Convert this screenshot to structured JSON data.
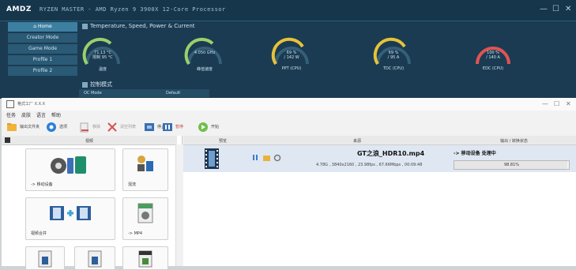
{
  "ryzen": {
    "logo": "AMDZ",
    "title": "RYZEN MASTER - AMD Ryzen 9 3900X 12-Core Processor",
    "nav": [
      "Home",
      "Creator Mode",
      "Game Mode",
      "Profile 1",
      "Profile 2"
    ],
    "section1": "Temperature, Speed, Power & Current",
    "gauges": [
      {
        "value": "71.13 °C\n限制 95 °C",
        "label": "温度",
        "color": "#9ad06a"
      },
      {
        "value": "4.050 GHz",
        "label": "峰值速度",
        "color": "#9ad06a"
      },
      {
        "value": "69 %\n/ 142 W",
        "label": "PPT (CPU)",
        "color": "#e6c23a"
      },
      {
        "value": "69 %\n/ 95 A",
        "label": "TDC (CPU)",
        "color": "#e6c23a"
      },
      {
        "value": "100 %\n/ 140 A",
        "label": "EDC (CPU)",
        "color": "#e05353"
      }
    ],
    "section2": "控制模式",
    "bottom_left": "OC Mode",
    "bottom_right": "Default"
  },
  "app": {
    "title": "格式工厂 X.X.X",
    "menu": [
      "任务",
      "皮肤",
      "语言",
      "帮助"
    ],
    "toolbar": [
      {
        "label": "输出文件夹",
        "icon": "output-folder-icon"
      },
      {
        "label": "选项",
        "icon": "options-icon"
      },
      {
        "label": "移除",
        "icon": "remove-icon"
      },
      {
        "label": "清空列表",
        "icon": "clear-list-icon"
      },
      {
        "label": "停止",
        "icon": "stop-icon"
      },
      {
        "label": "暂停",
        "icon": "pause-icon"
      },
      {
        "label": "开始",
        "icon": "start-icon"
      }
    ],
    "left_header": "视频",
    "tiles": [
      {
        "label": "-> 移动设备"
      },
      {
        "label": "混流"
      },
      {
        "label": "视频合并"
      },
      {
        "label": "-> MP4"
      },
      {
        "label": ""
      },
      {
        "label": ""
      },
      {
        "label": ""
      }
    ],
    "columns": [
      "预览",
      "来源",
      "输出 / 转换状态"
    ],
    "rows": [
      {
        "filename": "GT之浪_HDR10.mp4",
        "info": "4.78G , 3840x2160 , 23.98fps , 67.66Mbps , 00:09:48",
        "status": "-> 移动设备 处理中",
        "progress_text": "98.81%",
        "progress": 0.9881
      }
    ]
  }
}
